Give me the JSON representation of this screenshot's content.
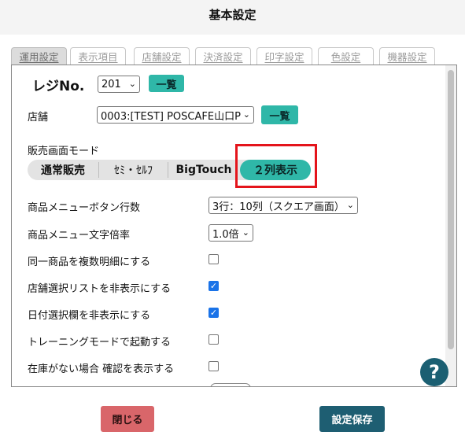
{
  "header": {
    "title": "基本設定"
  },
  "tabs": [
    {
      "label": "運用設定",
      "active": true
    },
    {
      "label": "表示項目",
      "active": false
    },
    {
      "label": "店舗設定",
      "active": false
    },
    {
      "label": "決済設定",
      "active": false
    },
    {
      "label": "印字設定",
      "active": false
    },
    {
      "label": "色設定",
      "active": false
    },
    {
      "label": "機器設定",
      "active": false
    }
  ],
  "register": {
    "label": "レジNo.",
    "value": "201",
    "list_button": "一覧"
  },
  "store": {
    "label": "店舗",
    "value": "0003:[TEST] POSCAFE山口P",
    "list_button": "一覧"
  },
  "sales_mode": {
    "label": "販売画面モード",
    "options": [
      "通常販売",
      "ｾﾐ・ｾﾙﾌ",
      "BigTouch",
      "２列表示"
    ],
    "selected": "２列表示"
  },
  "settings": {
    "menu_button_rows": {
      "label": "商品メニューボタン行数",
      "value": "3行：10列（スクエア画面）"
    },
    "menu_text_scale": {
      "label": "商品メニュー文字倍率",
      "value": "1.0倍"
    },
    "same_item_multi_line": {
      "label": "同一商品を複数明細にする",
      "checked": false
    },
    "hide_store_list": {
      "label": "店舗選択リストを非表示にする",
      "checked": true
    },
    "hide_date_field": {
      "label": "日付選択欄を非表示にする",
      "checked": true
    },
    "training_mode": {
      "label": "トレーニングモードで起動する",
      "checked": false
    },
    "stock_confirm": {
      "label": "在庫がない場合 確認を表示する",
      "checked": false
    }
  },
  "help_icon": "?",
  "footer": {
    "close_label": "閉じる",
    "save_label": "設定保存"
  },
  "colors": {
    "accent": "#2fb7a8",
    "save": "#1e5e72",
    "close": "#d9666a",
    "highlight": "#e4141b"
  },
  "icons": {
    "help": "question-circle-icon",
    "dropdown": "chevron-down-icon",
    "check": "checkmark-icon"
  }
}
